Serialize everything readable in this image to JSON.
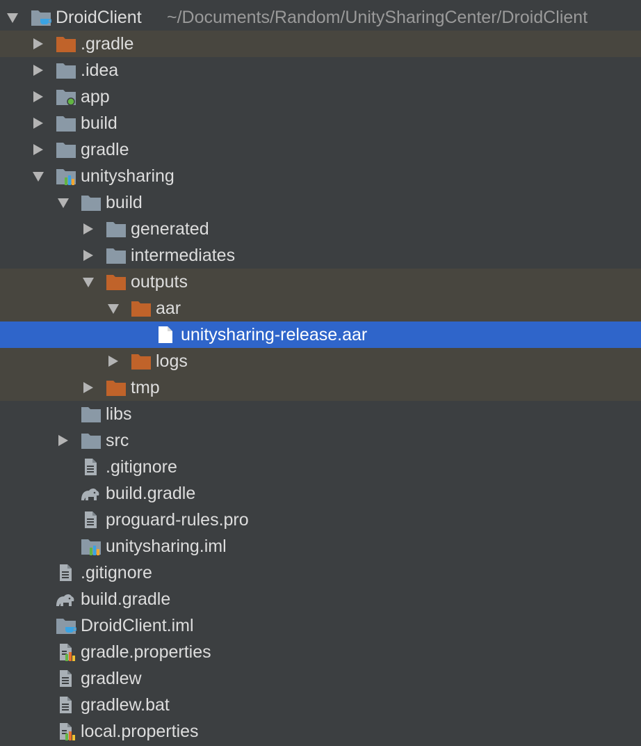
{
  "colors": {
    "background": "#3c3f41",
    "selection": "#2f65ca",
    "excluded_row": "#48463f",
    "folder": "#8a99a6",
    "excluded_folder": "#c0632a",
    "module_dot": "#62b543",
    "text": "#dddddd",
    "path_text": "#9a9a9a"
  },
  "tree": {
    "root": {
      "label": "DroidClient",
      "path": "~/Documents/Random/UnitySharingCenter/DroidClient",
      "icon": "project-folder-icon"
    },
    "nodes": [
      {
        "label": ".gradle",
        "icon": "excluded-folder-icon",
        "expanded": false
      },
      {
        "label": ".idea",
        "icon": "folder-icon",
        "expanded": false
      },
      {
        "label": "app",
        "icon": "app-module-folder-icon",
        "expanded": false
      },
      {
        "label": "build",
        "icon": "folder-icon",
        "expanded": false
      },
      {
        "label": "gradle",
        "icon": "folder-icon",
        "expanded": false
      },
      {
        "label": "unitysharing",
        "icon": "library-module-folder-icon",
        "expanded": true
      },
      {
        "label": "build",
        "icon": "folder-icon",
        "expanded": true
      },
      {
        "label": "generated",
        "icon": "folder-icon",
        "expanded": false
      },
      {
        "label": "intermediates",
        "icon": "folder-icon",
        "expanded": false
      },
      {
        "label": "outputs",
        "icon": "excluded-folder-icon",
        "expanded": true
      },
      {
        "label": "aar",
        "icon": "excluded-folder-icon",
        "expanded": true
      },
      {
        "label": "unitysharing-release.aar",
        "icon": "file-icon",
        "selected": true
      },
      {
        "label": "logs",
        "icon": "excluded-folder-icon",
        "expanded": false
      },
      {
        "label": "tmp",
        "icon": "excluded-folder-icon",
        "expanded": false
      },
      {
        "label": "libs",
        "icon": "folder-icon"
      },
      {
        "label": "src",
        "icon": "folder-icon",
        "expanded": false
      },
      {
        "label": ".gitignore",
        "icon": "text-file-icon"
      },
      {
        "label": "build.gradle",
        "icon": "gradle-elephant-icon"
      },
      {
        "label": "proguard-rules.pro",
        "icon": "text-file-icon"
      },
      {
        "label": "unitysharing.iml",
        "icon": "module-file-icon"
      },
      {
        "label": ".gitignore",
        "icon": "text-file-icon"
      },
      {
        "label": "build.gradle",
        "icon": "gradle-elephant-icon"
      },
      {
        "label": "DroidClient.iml",
        "icon": "project-folder-icon"
      },
      {
        "label": "gradle.properties",
        "icon": "properties-file-icon"
      },
      {
        "label": "gradlew",
        "icon": "text-file-icon"
      },
      {
        "label": "gradlew.bat",
        "icon": "text-file-icon"
      },
      {
        "label": "local.properties",
        "icon": "properties-file-icon"
      }
    ]
  }
}
